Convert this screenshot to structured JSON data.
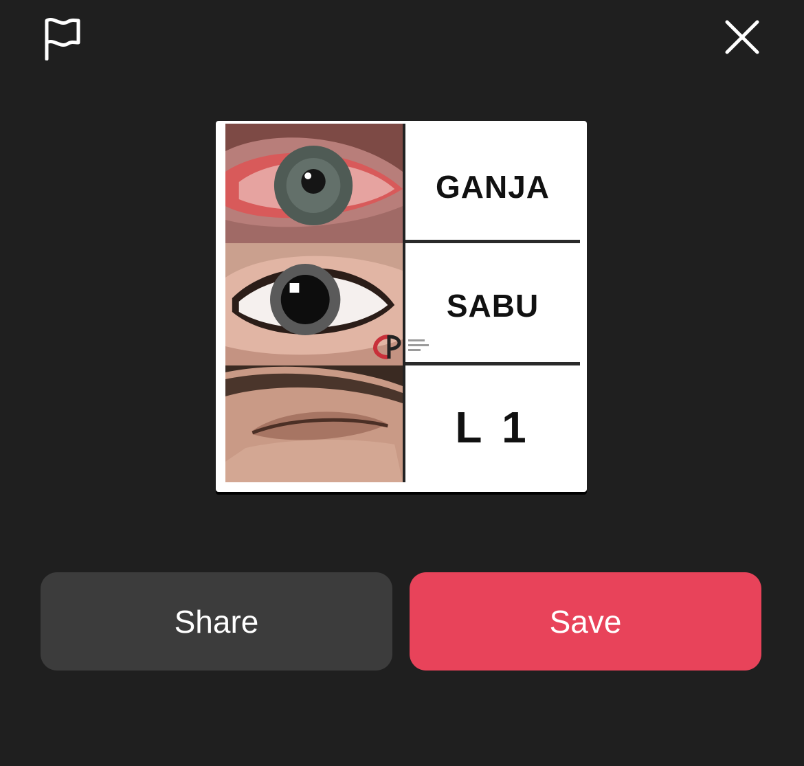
{
  "topbar": {
    "report_icon": "flag-icon",
    "close_icon": "close-icon"
  },
  "preview": {
    "rows": [
      {
        "label": "GANJA",
        "eye": "red-eye"
      },
      {
        "label": "SABU",
        "eye": "dilated-eye"
      },
      {
        "label": "L 1",
        "eye": "drowsy-eye"
      }
    ]
  },
  "actions": {
    "share_label": "Share",
    "save_label": "Save"
  },
  "colors": {
    "background": "#1f1f1f",
    "share_button": "#3c3c3c",
    "save_button": "#e8435a",
    "text": "#ffffff"
  }
}
